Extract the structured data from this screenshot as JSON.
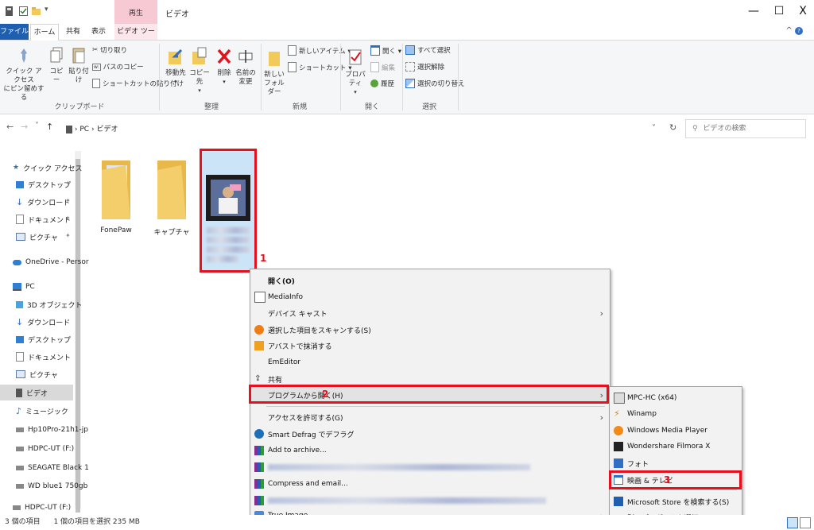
{
  "title_bar": {
    "context_tab": "再生",
    "window_title": "ビデオ",
    "minimize": "—",
    "maximize": "☐",
    "close": "X"
  },
  "tabs": {
    "file": "ファイル",
    "home": "ホーム",
    "share": "共有",
    "view": "表示",
    "video_tools": "ビデオ ツール"
  },
  "ribbon": {
    "quick_access_line1": "クイック アクセス",
    "quick_access_line2": "にピン留めする",
    "copy": "コピー",
    "paste": "貼り付け",
    "cut": "切り取り",
    "copy_path": "パスのコピー",
    "paste_shortcut": "ショートカットの貼り付け",
    "clipboard_group": "クリップボード",
    "move_to": "移動先",
    "copy_to": "コピー先",
    "delete": "削除",
    "rename_line1": "名前の",
    "rename_line2": "変更",
    "organize_group": "整理",
    "new_folder_line1": "新しい",
    "new_folder_line2": "フォルダー",
    "new_item": "新しいアイテム ▾",
    "shortcut": "ショートカット ▾",
    "new_group": "新規",
    "properties": "プロパティ",
    "open": "開く ▾",
    "edit": "編集",
    "history": "履歴",
    "open_group": "開く",
    "select_all": "すべて選択",
    "select_none": "選択解除",
    "invert_selection": "選択の切り替え",
    "select_group": "選択"
  },
  "address": {
    "back": "←",
    "forward": "→",
    "recent": "˅",
    "up": "↑",
    "path_pc": "PC",
    "path_sep": "›",
    "path_videos": "ビデオ",
    "dropdown": "˅",
    "refresh": "↻",
    "search_placeholder": "ビデオの検索"
  },
  "nav": {
    "quick_access": "クイック アクセス",
    "desktop": "デスクトップ",
    "downloads": "ダウンロード",
    "documents": "ドキュメント",
    "pictures": "ピクチャ",
    "onedrive": "OneDrive - Persor",
    "pc": "PC",
    "objects3d": "3D オブジェクト",
    "downloads2": "ダウンロード",
    "desktop2": "デスクトップ",
    "documents2": "ドキュメント",
    "pictures2": "ピクチャ",
    "videos": "ビデオ",
    "music": "ミュージック",
    "hp": "Hp10Pro-21h1-jp",
    "hdpc1": "HDPC-UT (F:)",
    "seagate": "SEAGATE Black 1",
    "wd": "WD blue1 750gb",
    "hdpc2": "HDPC-UT (F:)"
  },
  "content": {
    "folder1": "FonePaw",
    "folder2": "キャプチャ",
    "step1": "1",
    "step2": "2",
    "step3": "3"
  },
  "context_menu": {
    "open": "開く(O)",
    "mediainfo": "MediaInfo",
    "cast": "デバイス キャスト",
    "scan": "選択した項目をスキャンする(S)",
    "avast_shred": "アバストで抹消する",
    "emeditor": "EmEditor",
    "share": "共有",
    "open_with": "プログラムから開く(H)",
    "give_access": "アクセスを許可する(G)",
    "smart_defrag": "Smart Defrag でデフラグ",
    "add_archive": "Add to archive...",
    "compress_email": "Compress and email...",
    "true_image": "True Image"
  },
  "submenu": {
    "mpc": "MPC-HC (x64)",
    "winamp": "Winamp",
    "wmp": "Windows Media Player",
    "filmora": "Wondershare Filmora X",
    "photos": "フォト",
    "movies_tv": "映画 & テレビ",
    "store": "Microsoft Store を検索する(S)",
    "choose": "別のプログラムを選択(C)"
  },
  "status": {
    "count": "3 個の項目",
    "selected": "1 個の項目を選択  235 MB"
  },
  "colors": {
    "accent": "#1f5fb0",
    "highlight_red": "#e8101e",
    "context_tab": "#f6c9d3"
  }
}
